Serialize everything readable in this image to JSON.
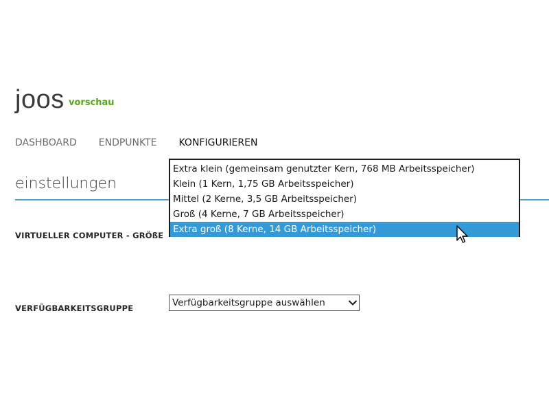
{
  "app": {
    "title": "joos",
    "badge": "vorschau"
  },
  "tabs": [
    {
      "label": "DASHBOARD",
      "active": false
    },
    {
      "label": "ENDPUNKTE",
      "active": false
    },
    {
      "label": "KONFIGURIEREN",
      "active": true
    }
  ],
  "section": {
    "title": "einstellungen",
    "accent_color": "#4fa3d6"
  },
  "fields": {
    "vm_size": {
      "label": "VIRTUELLER COMPUTER - GRÖßE",
      "options": [
        "Extra klein (gemeinsam genutzter Kern, 768 MB Arbeitsspeicher)",
        "Klein (1 Kern, 1,75 GB Arbeitsspeicher)",
        "Mittel (2 Kerne, 3,5 GB Arbeitsspeicher)",
        "Groß (4 Kerne, 7 GB Arbeitsspeicher)",
        "Extra groß (8 Kerne, 14 GB Arbeitsspeicher)"
      ],
      "highlighted_index": 4,
      "highlight_color": "#3399d7"
    },
    "availability_group": {
      "label": "VERFÜGBARKEITSGRUPPE",
      "selected_value": "Verfügbarkeitsgruppe auswählen",
      "icon": "chevron-down-icon"
    }
  },
  "colors": {
    "badge": "#5aa51f",
    "active_tab": "#111111",
    "inactive_tab": "#6b6b6b"
  }
}
